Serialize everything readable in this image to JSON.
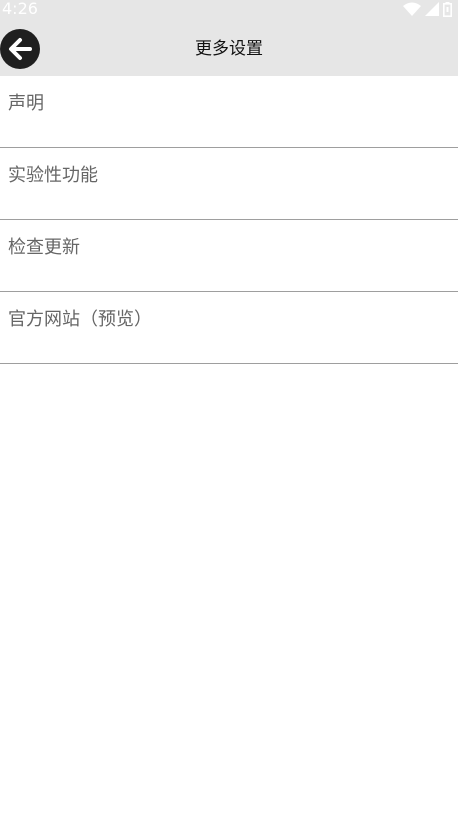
{
  "status_bar": {
    "time": "4:26",
    "icons": [
      "wifi-icon",
      "cell-signal-icon",
      "battery-icon"
    ]
  },
  "app_bar": {
    "back_icon": "arrow-left-icon",
    "title": "更多设置"
  },
  "menu": {
    "items": [
      {
        "label": "声明"
      },
      {
        "label": "实验性功能"
      },
      {
        "label": "检查更新"
      },
      {
        "label": "官方网站（预览）"
      }
    ]
  },
  "colors": {
    "bar_background": "#e6e6e6",
    "back_button": "#1f1f1f",
    "item_text": "#666666",
    "divider": "#9e9e9e"
  }
}
